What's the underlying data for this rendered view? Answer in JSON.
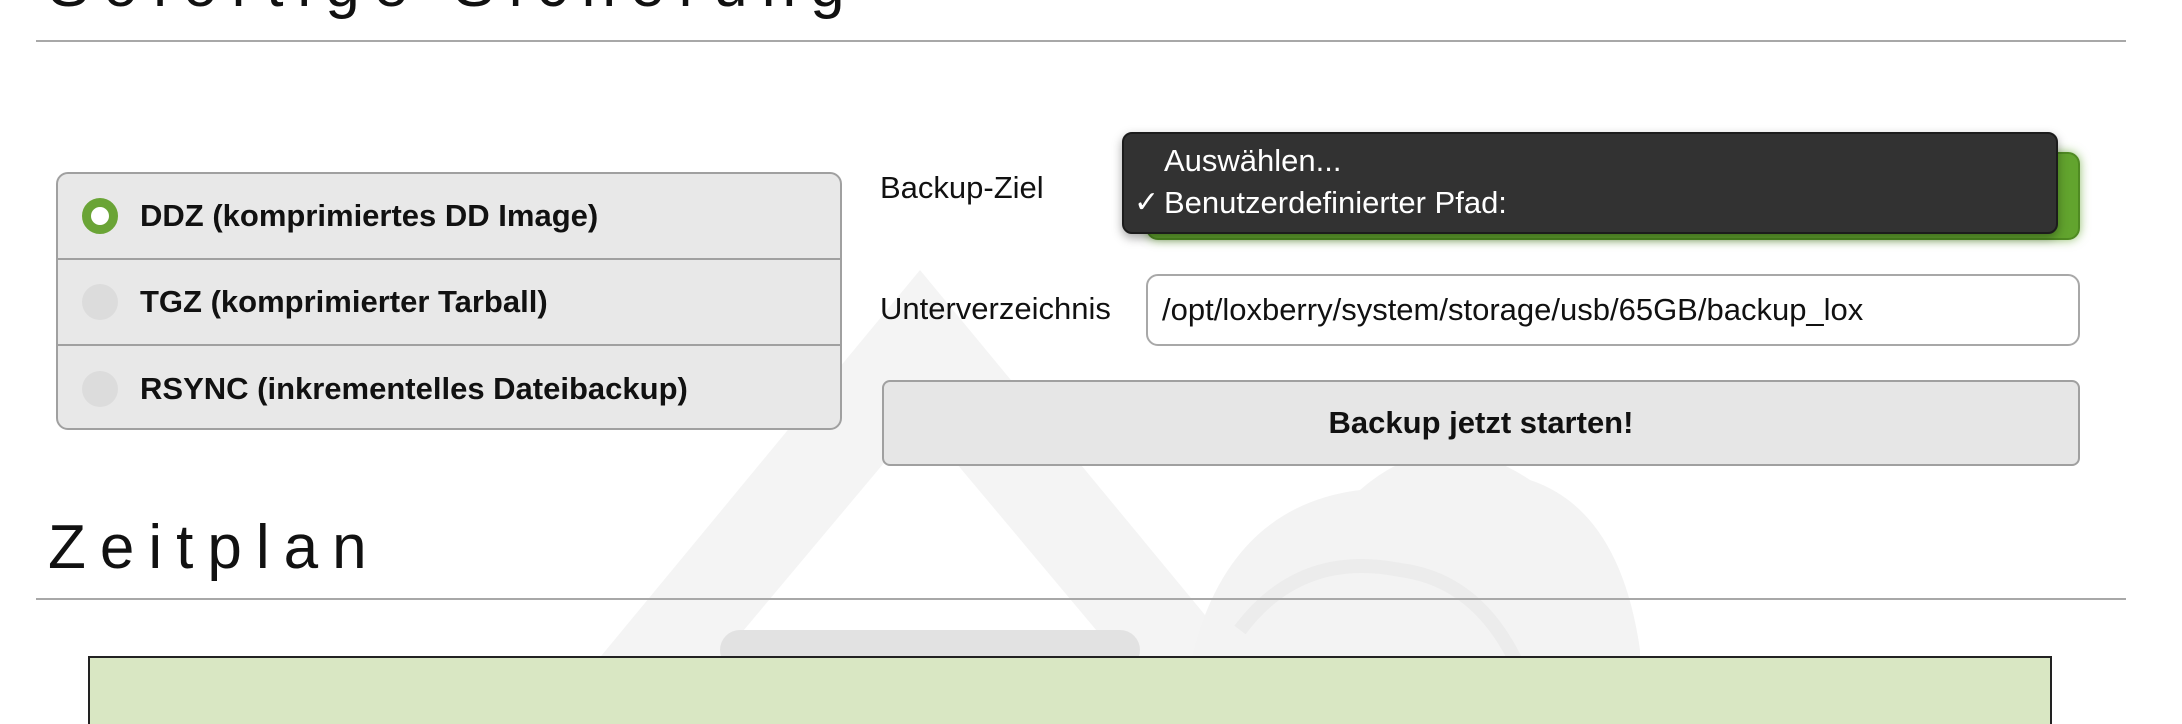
{
  "sections": {
    "top_heading": "Sofortige Sicherung",
    "schedule_heading": "Zeitplan"
  },
  "backup_type": {
    "options": [
      {
        "label": "DDZ (komprimiertes DD Image)",
        "selected": true
      },
      {
        "label": "TGZ (komprimierter Tarball)",
        "selected": false
      },
      {
        "label": "RSYNC (inkrementelles Dateibackup)",
        "selected": false
      }
    ]
  },
  "form": {
    "target_label": "Backup-Ziel",
    "subdir_label": "Unterverzeichnis",
    "subdir_value": "/opt/loxberry/system/storage/usb/65GB/backup_lox",
    "start_button": "Backup jetzt starten!"
  },
  "dropdown": {
    "options": [
      {
        "label": "Auswählen...",
        "checked": false
      },
      {
        "label": "Benutzerdefinierter Pfad:",
        "checked": true
      }
    ],
    "check_glyph": "✓"
  },
  "colors": {
    "accent_green": "#62a42e",
    "schedule_box": "#d9e7c3",
    "dropdown_bg": "#323232"
  },
  "icons": {
    "watermark": "loxberry-logo-watermark"
  }
}
